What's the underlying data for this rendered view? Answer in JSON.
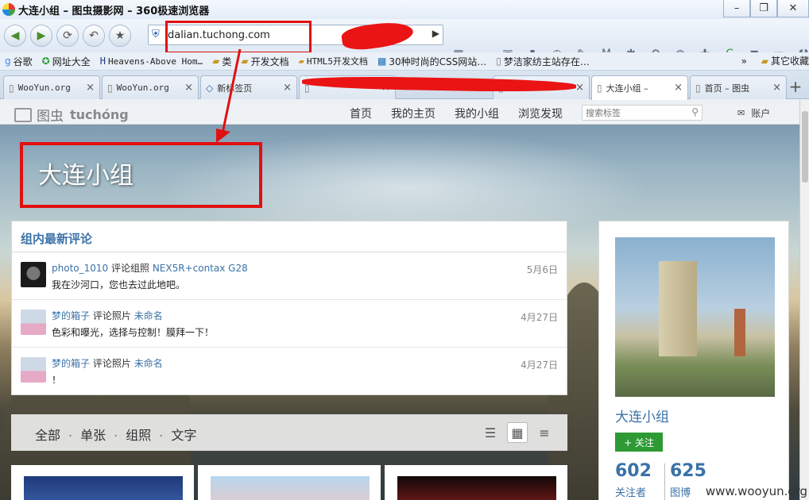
{
  "window": {
    "title": "大连小组 – 图虫摄影网 – 360极速浏览器",
    "controls": [
      "–",
      "❐",
      "✕"
    ]
  },
  "navbar": {
    "address_prefix": "dalian.",
    "address_domain": "tuchong.com",
    "address_value": "dalian.tuchong.com"
  },
  "bookmarks": {
    "items": [
      {
        "label": "谷歌",
        "icon": "google-icon"
      },
      {
        "label": "网址大全",
        "icon": "star-circle-icon"
      },
      {
        "label": "Heavens-Above Hom…",
        "icon": "ha-icon"
      },
      {
        "label": "类",
        "icon": "folder-icon"
      },
      {
        "label": "开发文档",
        "icon": "folder-icon"
      },
      {
        "label": "HTML5开发文档",
        "icon": "folder-icon"
      },
      {
        "label": "30种时尚的CSS网站…",
        "icon": "coolshell-icon"
      },
      {
        "label": "梦洁家纺主站存在…",
        "icon": "page-icon"
      }
    ],
    "more": "»",
    "other_label": "其它收藏"
  },
  "tabs": [
    {
      "label": "WooYun.org",
      "mono": true
    },
    {
      "label": "WooYun.org",
      "mono": true
    },
    {
      "label": "新标签页",
      "mono": false
    },
    {
      "label": "",
      "mono": false
    },
    {
      "label": "",
      "mono": false
    },
    {
      "label": "大连小组 –",
      "mono": false,
      "active": true
    },
    {
      "label": "首页 – 图虫",
      "mono": false
    }
  ],
  "site": {
    "logo_cn": "图虫",
    "logo_en": "tuchóng",
    "nav": [
      "首页",
      "我的主页",
      "我的小组",
      "浏览发现"
    ],
    "search_placeholder": "搜索标签",
    "account": "账户"
  },
  "group": {
    "title": "大连小组"
  },
  "comments": {
    "header": "组内最新评论",
    "items": [
      {
        "user": "photo_1010",
        "verb": "评论组照",
        "target": "NEX5R+contax G28",
        "body": "我在沙河口，您也去过此地吧。",
        "date": "5月6日",
        "avatar": "#1a1a1a"
      },
      {
        "user": "梦的箱子",
        "verb": "评论照片",
        "target": "未命名",
        "body": "色彩和曝光，选择与控制！膜拜一下！",
        "date": "4月27日",
        "avatar": "#c9d6e6"
      },
      {
        "user": "梦的箱子",
        "verb": "评论照片",
        "target": "未命名",
        "body": "！",
        "date": "4月27日",
        "avatar": "#c9d6e6"
      }
    ]
  },
  "filters": [
    "全部",
    "单张",
    "组照",
    "文字"
  ],
  "sidebar": {
    "name": "大连小组",
    "follow_label": "+ 关注",
    "followers_count": "602",
    "followers_label": "关注者",
    "blogs_count": "625",
    "blogs_label": "图博"
  },
  "watermark": "www.wooyun.org",
  "colors": {
    "annotation_red": "#e01010",
    "link_blue": "#3a72a8",
    "follow_green": "#2e9a35"
  }
}
